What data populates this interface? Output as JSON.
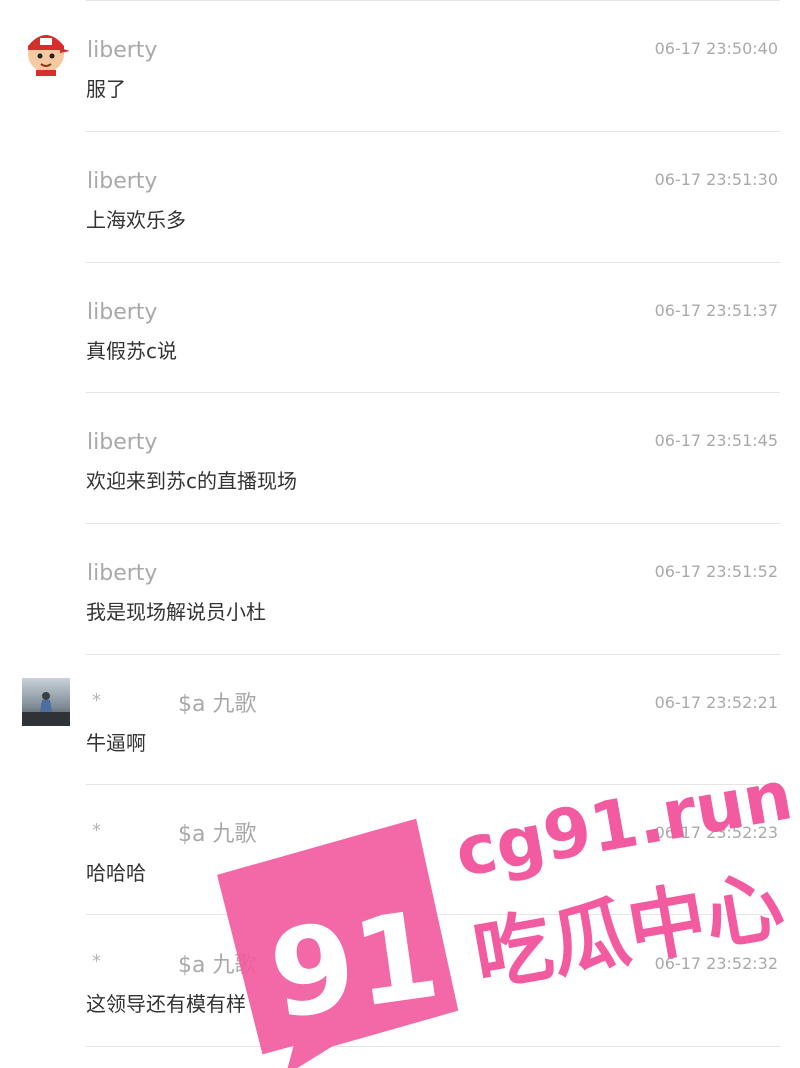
{
  "chat": {
    "messages": [
      {
        "user": "liberty",
        "time": "06-17 23:50:40",
        "text": "服了",
        "avatar": "cartoon-boy-red-cap"
      },
      {
        "user": "liberty",
        "time": "06-17 23:51:30",
        "text": "上海欢乐多"
      },
      {
        "user": "liberty",
        "time": "06-17 23:51:37",
        "text": "真假苏c说"
      },
      {
        "user": "liberty",
        "time": "06-17 23:51:45",
        "text": "欢迎来到苏c的直播现场"
      },
      {
        "user": "liberty",
        "time": "06-17 23:51:52",
        "text": "我是现场解说员小杜"
      },
      {
        "star": "*",
        "user": "$a 九歌",
        "time": "06-17 23:52:21",
        "text": "牛逼啊",
        "avatar": "person-photo"
      },
      {
        "star": "*",
        "user": "$a 九歌",
        "time": "06-17 23:52:23",
        "text": "哈哈哈"
      },
      {
        "star": "*",
        "user": "$a 九歌",
        "time": "06-17 23:52:32",
        "text": "这领导还有模有样"
      }
    ]
  },
  "watermark": {
    "number": "91",
    "site": "cg91.run",
    "slogan": "吃瓜中心",
    "color": "#f25b9f"
  }
}
